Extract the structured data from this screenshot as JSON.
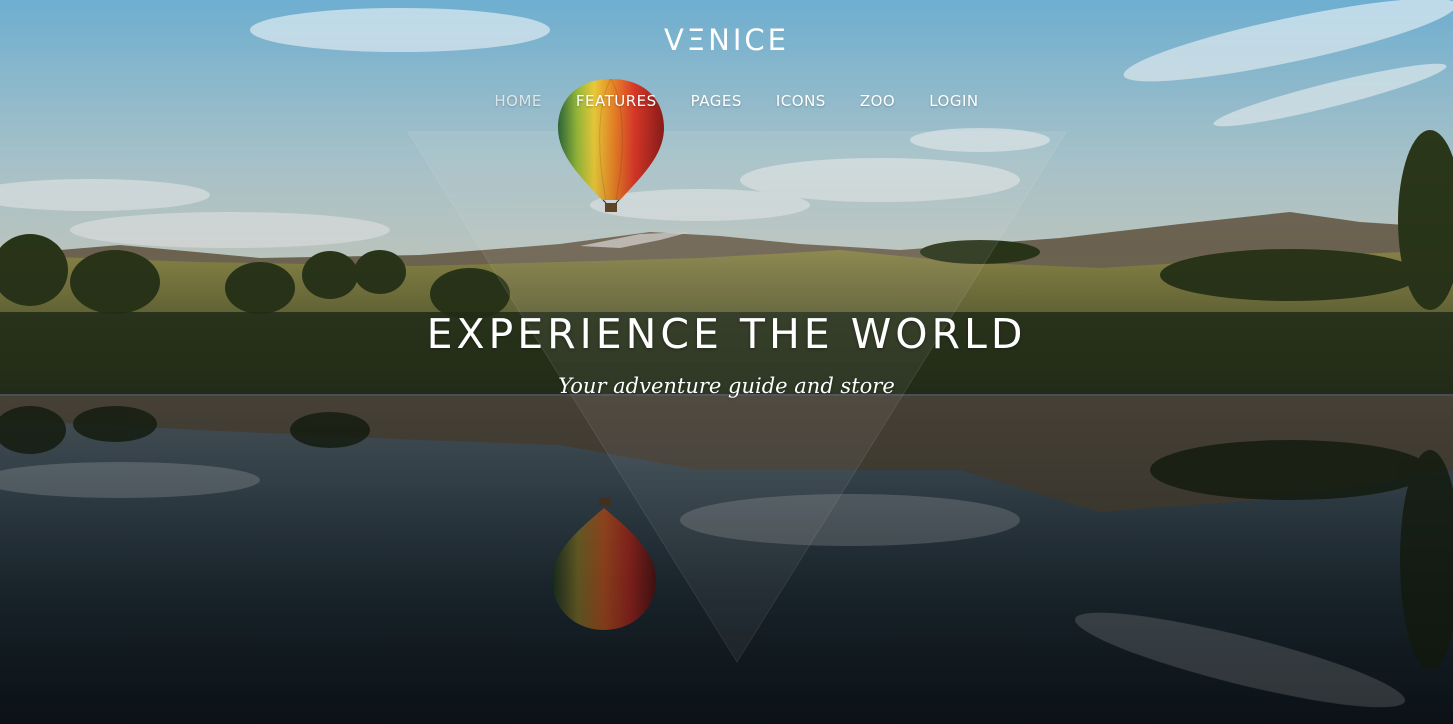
{
  "brand": {
    "logo_text": "VΞNICE"
  },
  "nav": {
    "items": [
      {
        "label": "HOME",
        "state": "muted"
      },
      {
        "label": "FEATURES",
        "state": "active"
      },
      {
        "label": "PAGES",
        "state": "normal"
      },
      {
        "label": "ICONS",
        "state": "normal"
      },
      {
        "label": "ZOO",
        "state": "normal"
      },
      {
        "label": "LOGIN",
        "state": "normal"
      }
    ]
  },
  "hero": {
    "headline": "EXPERIENCE THE WORLD",
    "tagline": "Your adventure guide and store",
    "background_icon": "hot-air-balloon-landscape-image"
  },
  "colors": {
    "sky_top": "#7fb7d4",
    "sky_bottom": "#dbe7e2",
    "hills": "#8e8a4f",
    "water": "#1e2c36",
    "text": "#ffffff"
  }
}
